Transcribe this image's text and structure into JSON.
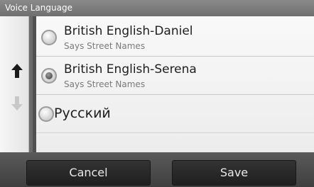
{
  "title": "Voice Language",
  "scroll": {
    "up_icon": "arrow-up-icon",
    "down_icon": "arrow-down-icon"
  },
  "options": [
    {
      "label": "British English-Daniel",
      "sublabel": "Says Street Names",
      "selected": false
    },
    {
      "label": "British English-Serena",
      "sublabel": "Says Street Names",
      "selected": true
    },
    {
      "label": "Русский",
      "sublabel": "",
      "selected": false
    }
  ],
  "buttons": {
    "cancel": "Cancel",
    "save": "Save"
  },
  "colors": {
    "title_bar": "#7d7d7d",
    "list_bg": "#f3f3f3",
    "button_bg": "#2a2a2a",
    "bottom_bar": "#4a4a4a"
  }
}
